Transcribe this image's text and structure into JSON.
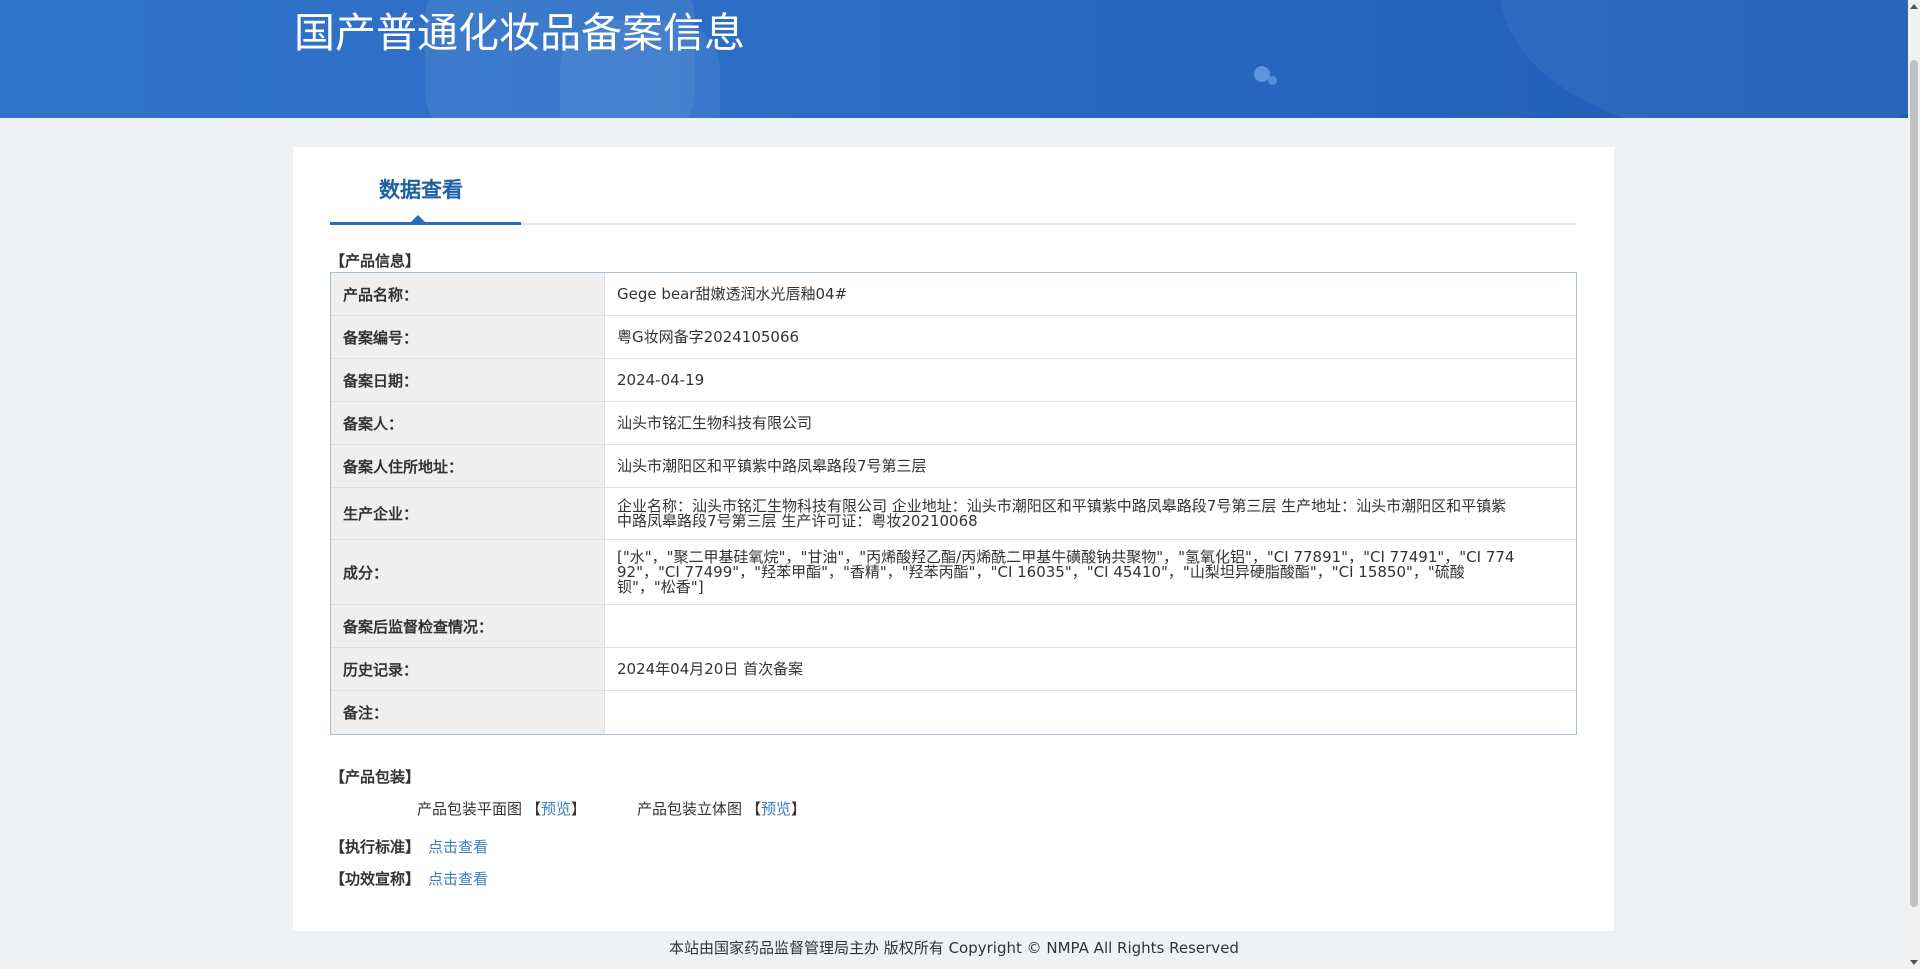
{
  "header": {
    "title": "国产普通化妆品备案信息"
  },
  "tabs": [
    {
      "label": "数据查看",
      "active": true
    }
  ],
  "product_info": {
    "section_title": "【产品信息】",
    "rows": [
      {
        "label": "产品名称：",
        "value": "Gege bear甜嫩透润水光唇釉04#"
      },
      {
        "label": "备案编号：",
        "value": "粤G妆网备字2024105066"
      },
      {
        "label": "备案日期：",
        "value": "2024-04-19"
      },
      {
        "label": "备案人：",
        "value": "汕头市铭汇生物科技有限公司"
      },
      {
        "label": "备案人住所地址：",
        "value": "汕头市潮阳区和平镇紫中路凤皋路段7号第三层"
      },
      {
        "label": "生产企业：",
        "value": "企业名称：汕头市铭汇生物科技有限公司 企业地址：汕头市潮阳区和平镇紫中路凤皋路段7号第三层 生产地址：汕头市潮阳区和平镇紫中路凤皋路段7号第三层 生产许可证：粤妆20210068"
      },
      {
        "label": "成分：",
        "value": "[\"水\"，\"聚二甲基硅氧烷\"，\"甘油\"，\"丙烯酸羟乙酯/丙烯酰二甲基牛磺酸钠共聚物\"，\"氢氧化铝\"，\"CI 77891\"，\"CI 77491\"，\"CI 77492\"，\"CI 77499\"，\"羟苯甲酯\"，\"香精\"，\"羟苯丙酯\"，\"CI 16035\"，\"CI 45410\"，\"山梨坦异硬脂酸酯\"，\"CI 15850\"，\"硫酸钡\"，\"松香\"]"
      },
      {
        "label": "备案后监督检查情况：",
        "value": ""
      },
      {
        "label": "历史记录：",
        "value": "2024年04月20日 首次备案"
      },
      {
        "label": "备注：",
        "value": ""
      }
    ]
  },
  "packaging": {
    "section_title": "【产品包装】",
    "items": [
      {
        "label": "产品包装平面图",
        "bracket_open": "【",
        "link": "预览",
        "bracket_close": "】"
      },
      {
        "label": "产品包装立体图",
        "bracket_open": "【",
        "link": "预览",
        "bracket_close": "】"
      }
    ]
  },
  "standard": {
    "label": "【执行标准】",
    "link": "点击查看"
  },
  "efficacy": {
    "label": "【功效宣称】",
    "link": "点击查看"
  },
  "footer": {
    "text": "本站由国家药品监督管理局主办 版权所有 Copyright © NMPA All Rights Reserved"
  },
  "theme": {
    "header_blue": "#2b6cc4",
    "link_blue": "#3a7cc0",
    "tab_blue": "#1f5fa6"
  }
}
